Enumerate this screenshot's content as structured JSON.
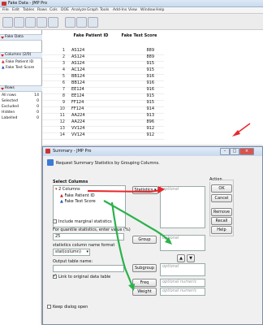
{
  "app": {
    "title": "Fake Data - JMP Pro",
    "menu": [
      "File",
      "Edit",
      "Tables",
      "Rows",
      "Cols",
      "DOE",
      "Analyze",
      "Graph",
      "Tools",
      "Add-Ins",
      "View",
      "Window",
      "Help"
    ]
  },
  "left_panel": {
    "table_name": "Fake Data",
    "columns_header": "Columns (2/0)",
    "columns": [
      "Fake Patient ID",
      "Fake Test Score"
    ],
    "rows_header": "Rows",
    "row_stats": [
      {
        "label": "All rows",
        "value": "14"
      },
      {
        "label": "Selected",
        "value": "0"
      },
      {
        "label": "Excluded",
        "value": "0"
      },
      {
        "label": "Hidden",
        "value": "0"
      },
      {
        "label": "Labelled",
        "value": "0"
      }
    ]
  },
  "table": {
    "headers": [
      "Fake Patient ID",
      "Fake Test Score"
    ],
    "rows": [
      [
        "1",
        "AS124",
        "889"
      ],
      [
        "2",
        "AS124",
        "889"
      ],
      [
        "3",
        "AS124",
        "915"
      ],
      [
        "4",
        "AC124",
        "915"
      ],
      [
        "5",
        "BB124",
        "916"
      ],
      [
        "6",
        "BB124",
        "916"
      ],
      [
        "7",
        "EE124",
        "916"
      ],
      [
        "8",
        "EE124",
        "915"
      ],
      [
        "9",
        "FF124",
        "915"
      ],
      [
        "10",
        "FF124",
        "914"
      ],
      [
        "11",
        "AA224",
        "913"
      ],
      [
        "12",
        "AA224",
        "896"
      ],
      [
        "13",
        "VV124",
        "912"
      ],
      [
        "14",
        "VV124",
        "912"
      ]
    ]
  },
  "dialog": {
    "title": "Summary - JMP Pro",
    "description": "Request Summary Statistics by Grouping Columns.",
    "select_columns_label": "Select Columns",
    "columns_count": "2 Columns",
    "columns": [
      "Fake Patient ID",
      "Fake Test Score"
    ],
    "statistics_button": "Statistics",
    "optional": "optional",
    "group_button": "Group",
    "subgroup_button": "Subgroup",
    "freq_button": "Freq",
    "weight_button": "Weight",
    "optional_numeric": "optional numeric",
    "action_label": "Action",
    "ok": "OK",
    "cancel": "Cancel",
    "remove": "Remove",
    "recall": "Recall",
    "help": "Help",
    "include_marginal": "Include marginal statistics",
    "quantile_label": "For quantile statistics, enter value (%)",
    "quantile_value": "25",
    "stat_format_label": "statistics column name format",
    "stat_format_value": "stat(column)",
    "output_name_label": "Output table name:",
    "link_label": "Link to original data table",
    "keep_open": "Keep dialog open"
  },
  "colors": {
    "annotation_red": "#e8262a",
    "annotation_green": "#2bb24c"
  }
}
